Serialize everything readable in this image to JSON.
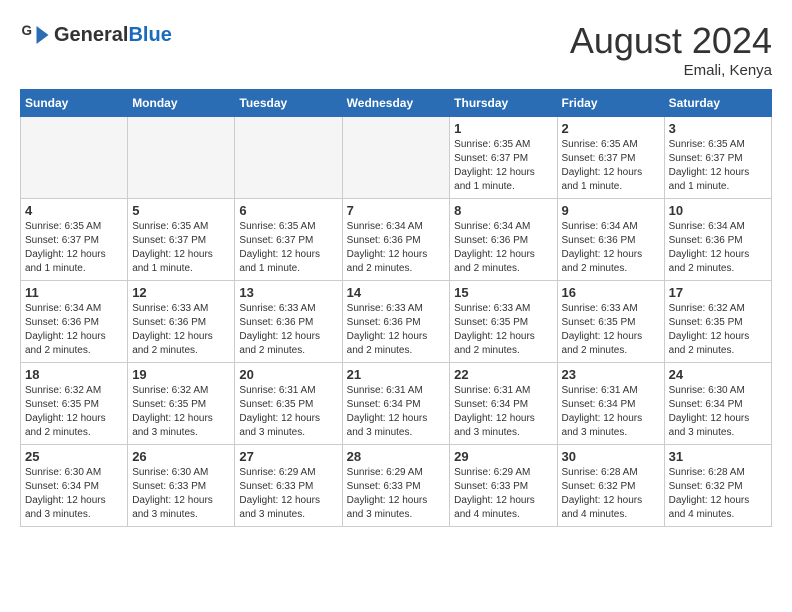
{
  "header": {
    "logo_general": "General",
    "logo_blue": "Blue",
    "month_year": "August 2024",
    "location": "Emali, Kenya"
  },
  "weekdays": [
    "Sunday",
    "Monday",
    "Tuesday",
    "Wednesday",
    "Thursday",
    "Friday",
    "Saturday"
  ],
  "weeks": [
    [
      {
        "day": "",
        "info": ""
      },
      {
        "day": "",
        "info": ""
      },
      {
        "day": "",
        "info": ""
      },
      {
        "day": "",
        "info": ""
      },
      {
        "day": "1",
        "info": "Sunrise: 6:35 AM\nSunset: 6:37 PM\nDaylight: 12 hours\nand 1 minute."
      },
      {
        "day": "2",
        "info": "Sunrise: 6:35 AM\nSunset: 6:37 PM\nDaylight: 12 hours\nand 1 minute."
      },
      {
        "day": "3",
        "info": "Sunrise: 6:35 AM\nSunset: 6:37 PM\nDaylight: 12 hours\nand 1 minute."
      }
    ],
    [
      {
        "day": "4",
        "info": "Sunrise: 6:35 AM\nSunset: 6:37 PM\nDaylight: 12 hours\nand 1 minute."
      },
      {
        "day": "5",
        "info": "Sunrise: 6:35 AM\nSunset: 6:37 PM\nDaylight: 12 hours\nand 1 minute."
      },
      {
        "day": "6",
        "info": "Sunrise: 6:35 AM\nSunset: 6:37 PM\nDaylight: 12 hours\nand 1 minute."
      },
      {
        "day": "7",
        "info": "Sunrise: 6:34 AM\nSunset: 6:36 PM\nDaylight: 12 hours\nand 2 minutes."
      },
      {
        "day": "8",
        "info": "Sunrise: 6:34 AM\nSunset: 6:36 PM\nDaylight: 12 hours\nand 2 minutes."
      },
      {
        "day": "9",
        "info": "Sunrise: 6:34 AM\nSunset: 6:36 PM\nDaylight: 12 hours\nand 2 minutes."
      },
      {
        "day": "10",
        "info": "Sunrise: 6:34 AM\nSunset: 6:36 PM\nDaylight: 12 hours\nand 2 minutes."
      }
    ],
    [
      {
        "day": "11",
        "info": "Sunrise: 6:34 AM\nSunset: 6:36 PM\nDaylight: 12 hours\nand 2 minutes."
      },
      {
        "day": "12",
        "info": "Sunrise: 6:33 AM\nSunset: 6:36 PM\nDaylight: 12 hours\nand 2 minutes."
      },
      {
        "day": "13",
        "info": "Sunrise: 6:33 AM\nSunset: 6:36 PM\nDaylight: 12 hours\nand 2 minutes."
      },
      {
        "day": "14",
        "info": "Sunrise: 6:33 AM\nSunset: 6:36 PM\nDaylight: 12 hours\nand 2 minutes."
      },
      {
        "day": "15",
        "info": "Sunrise: 6:33 AM\nSunset: 6:35 PM\nDaylight: 12 hours\nand 2 minutes."
      },
      {
        "day": "16",
        "info": "Sunrise: 6:33 AM\nSunset: 6:35 PM\nDaylight: 12 hours\nand 2 minutes."
      },
      {
        "day": "17",
        "info": "Sunrise: 6:32 AM\nSunset: 6:35 PM\nDaylight: 12 hours\nand 2 minutes."
      }
    ],
    [
      {
        "day": "18",
        "info": "Sunrise: 6:32 AM\nSunset: 6:35 PM\nDaylight: 12 hours\nand 2 minutes."
      },
      {
        "day": "19",
        "info": "Sunrise: 6:32 AM\nSunset: 6:35 PM\nDaylight: 12 hours\nand 3 minutes."
      },
      {
        "day": "20",
        "info": "Sunrise: 6:31 AM\nSunset: 6:35 PM\nDaylight: 12 hours\nand 3 minutes."
      },
      {
        "day": "21",
        "info": "Sunrise: 6:31 AM\nSunset: 6:34 PM\nDaylight: 12 hours\nand 3 minutes."
      },
      {
        "day": "22",
        "info": "Sunrise: 6:31 AM\nSunset: 6:34 PM\nDaylight: 12 hours\nand 3 minutes."
      },
      {
        "day": "23",
        "info": "Sunrise: 6:31 AM\nSunset: 6:34 PM\nDaylight: 12 hours\nand 3 minutes."
      },
      {
        "day": "24",
        "info": "Sunrise: 6:30 AM\nSunset: 6:34 PM\nDaylight: 12 hours\nand 3 minutes."
      }
    ],
    [
      {
        "day": "25",
        "info": "Sunrise: 6:30 AM\nSunset: 6:34 PM\nDaylight: 12 hours\nand 3 minutes."
      },
      {
        "day": "26",
        "info": "Sunrise: 6:30 AM\nSunset: 6:33 PM\nDaylight: 12 hours\nand 3 minutes."
      },
      {
        "day": "27",
        "info": "Sunrise: 6:29 AM\nSunset: 6:33 PM\nDaylight: 12 hours\nand 3 minutes."
      },
      {
        "day": "28",
        "info": "Sunrise: 6:29 AM\nSunset: 6:33 PM\nDaylight: 12 hours\nand 3 minutes."
      },
      {
        "day": "29",
        "info": "Sunrise: 6:29 AM\nSunset: 6:33 PM\nDaylight: 12 hours\nand 4 minutes."
      },
      {
        "day": "30",
        "info": "Sunrise: 6:28 AM\nSunset: 6:32 PM\nDaylight: 12 hours\nand 4 minutes."
      },
      {
        "day": "31",
        "info": "Sunrise: 6:28 AM\nSunset: 6:32 PM\nDaylight: 12 hours\nand 4 minutes."
      }
    ]
  ]
}
